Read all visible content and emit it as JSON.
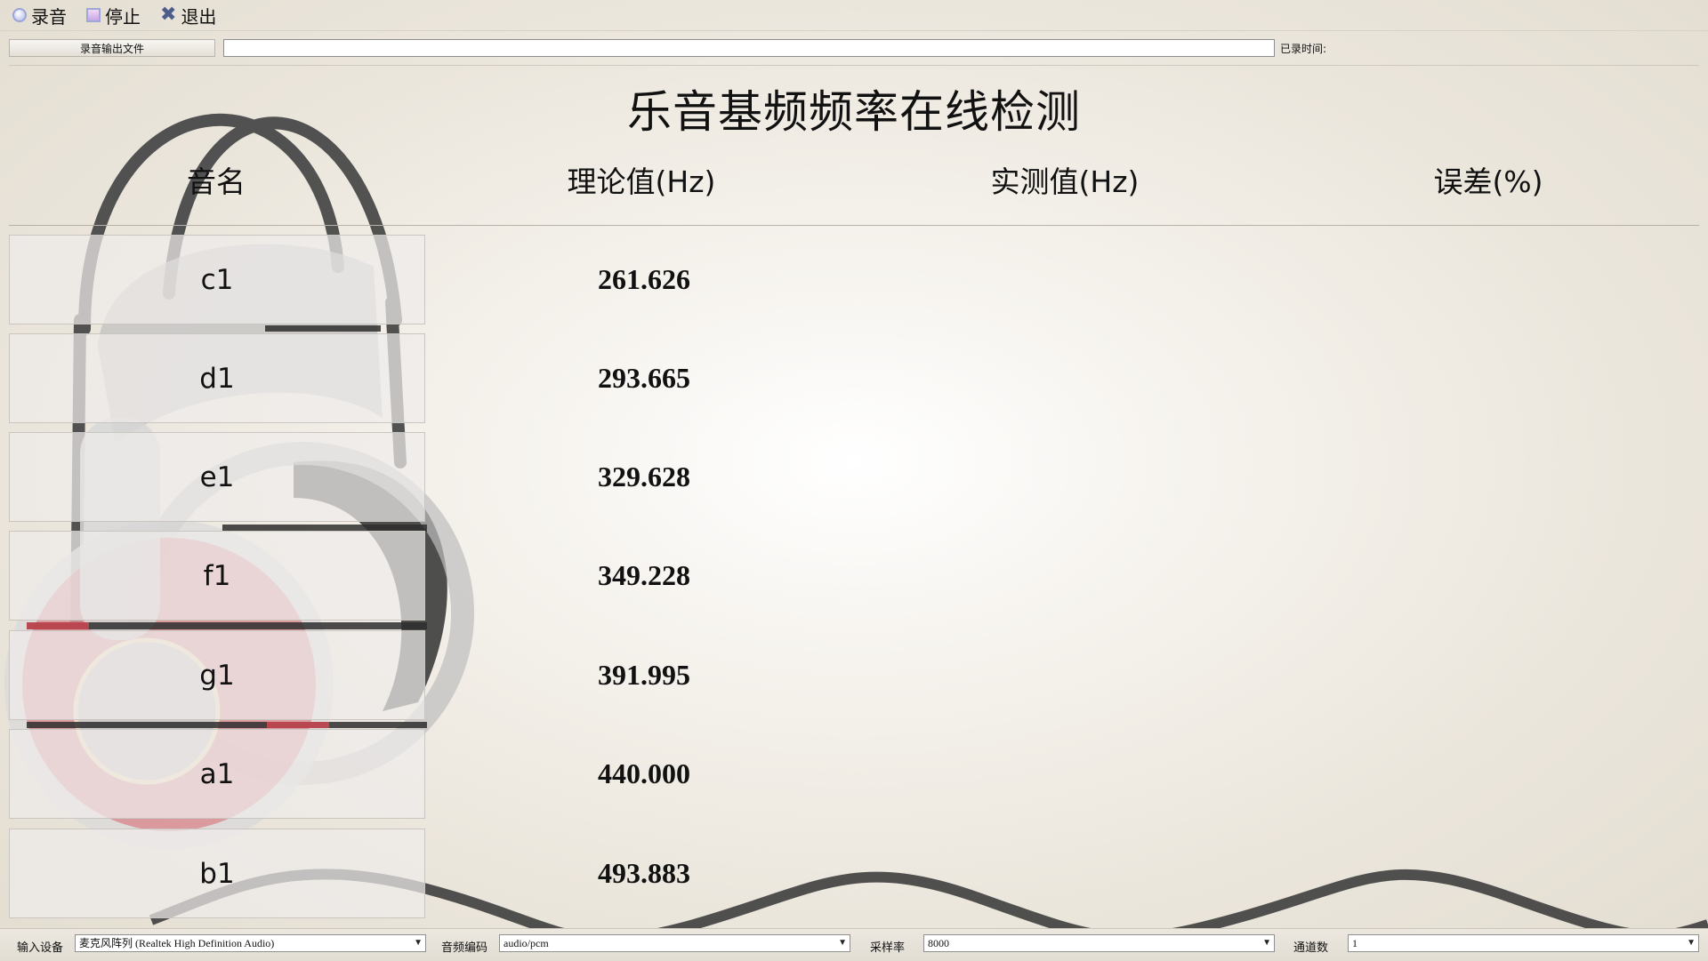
{
  "toolbar": {
    "record_label": "录音",
    "stop_label": "停止",
    "exit_label": "退出"
  },
  "file_row": {
    "button_label": "录音输出文件",
    "path_value": "",
    "elapsed_label": "已录时间:"
  },
  "title": "乐音基频频率在线检测",
  "table": {
    "headers": [
      "音名",
      "理论值(Hz)",
      "实测值(Hz)",
      "误差(%)"
    ],
    "rows": [
      {
        "note": "c1",
        "theory": "261.626",
        "measured": "",
        "error": ""
      },
      {
        "note": "d1",
        "theory": "293.665",
        "measured": "",
        "error": ""
      },
      {
        "note": "e1",
        "theory": "329.628",
        "measured": "",
        "error": ""
      },
      {
        "note": "f1",
        "theory": "349.228",
        "measured": "",
        "error": ""
      },
      {
        "note": "g1",
        "theory": "391.995",
        "measured": "",
        "error": ""
      },
      {
        "note": "a1",
        "theory": "440.000",
        "measured": "",
        "error": ""
      },
      {
        "note": "b1",
        "theory": "493.883",
        "measured": "",
        "error": ""
      }
    ]
  },
  "statusbar": {
    "input_device_label": "输入设备",
    "input_device_value": "麦克风阵列 (Realtek High Definition Audio)",
    "codec_label": "音频编码",
    "codec_value": "audio/pcm",
    "sample_rate_label": "采样率",
    "sample_rate_value": "8000",
    "channels_label": "通道数",
    "channels_value": "1"
  },
  "icons": {
    "record": "record-icon",
    "stop": "stop-icon",
    "exit": "close-icon",
    "dropdown": "chevron-down-icon"
  },
  "colors": {
    "headphone_accent": "#d64a55",
    "headphone_band": "#3a3a3a"
  }
}
